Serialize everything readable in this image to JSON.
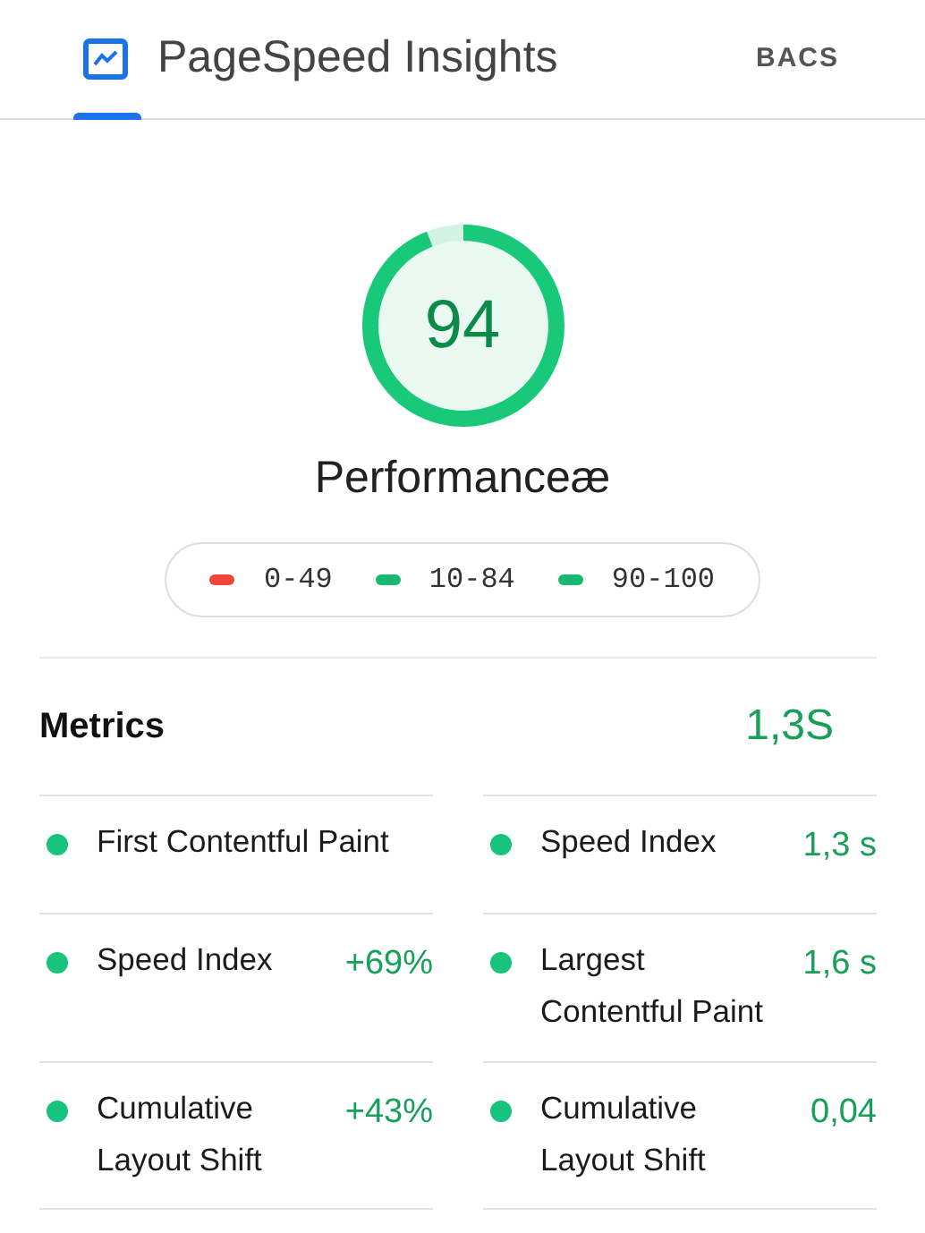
{
  "header": {
    "title": "PageSpeed Insights",
    "action": "BACS"
  },
  "score": {
    "value": "94",
    "label": "Performanceæ"
  },
  "legend": [
    {
      "range": "0-49",
      "color": "#f0453a"
    },
    {
      "range": "10-84",
      "color": "#18b96e"
    },
    {
      "range": "90-100",
      "color": "#18b96e"
    }
  ],
  "metrics": {
    "title": "Metrics",
    "summary": "1,3S",
    "items": [
      {
        "name": "First Contentful Paint",
        "color": "#18c47c"
      },
      {
        "name": "Speed Index",
        "value": "1,3 s",
        "color": "#18c47c"
      },
      {
        "name": "Speed Index",
        "value": "+69%",
        "color": "#18c47c"
      },
      {
        "name": "Largest Contentful Paint",
        "value": "1,6 s",
        "color": "#18c47c"
      },
      {
        "name": "Cumulative Layout Shift",
        "value": "+43%",
        "color": "#18c47c"
      },
      {
        "name": "Cumulative Layout Shift",
        "value": "0,04",
        "color": "#18c47c"
      }
    ]
  }
}
